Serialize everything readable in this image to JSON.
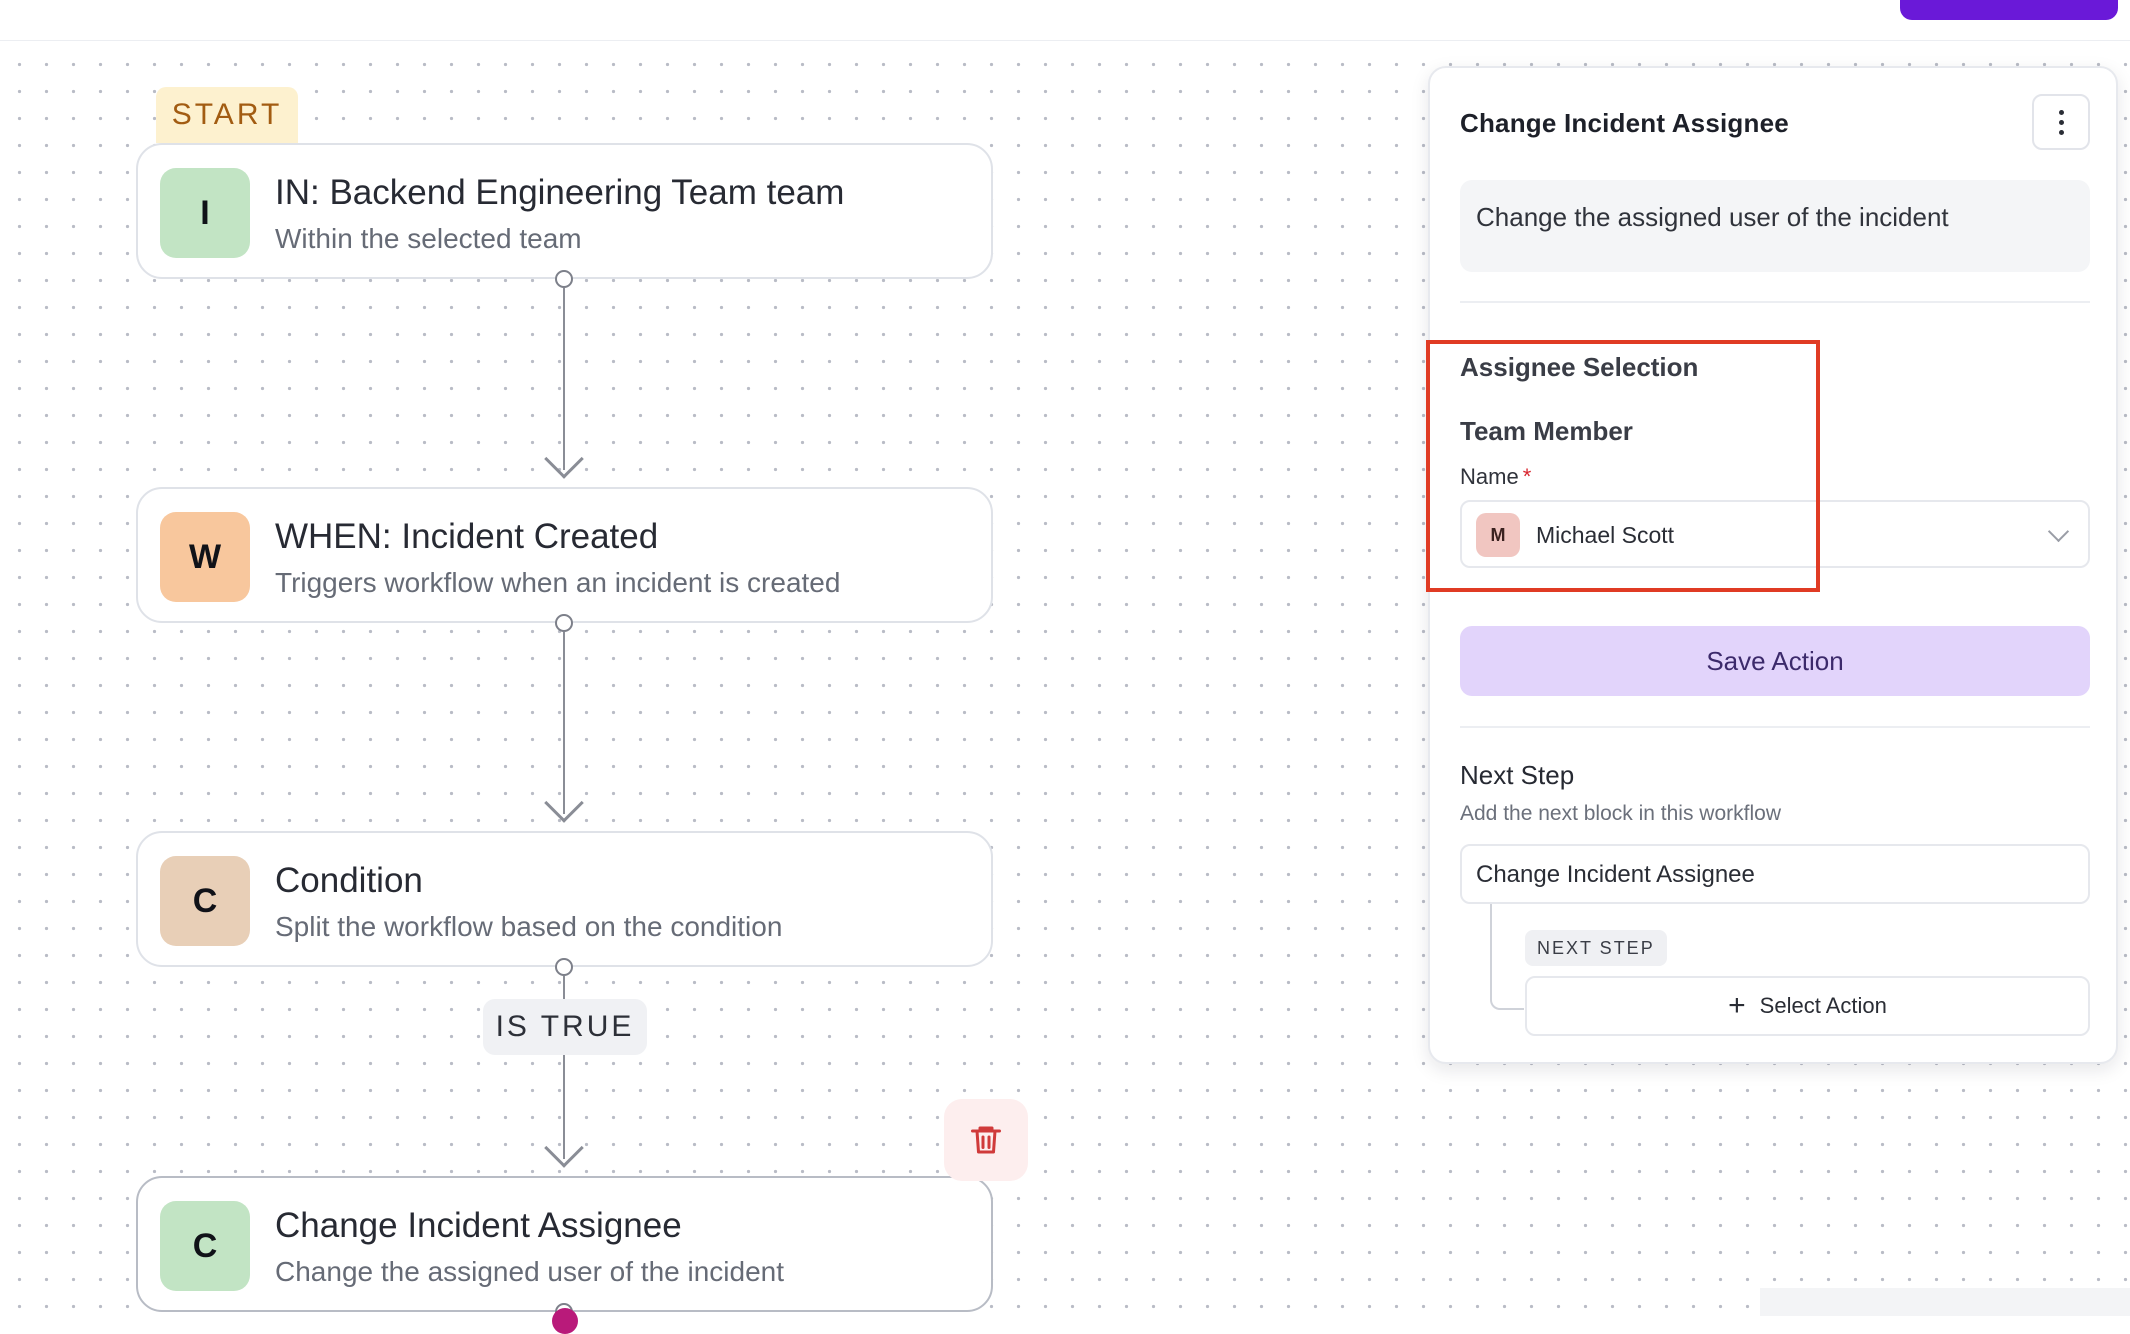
{
  "canvas": {
    "start_label": "START",
    "nodes": [
      {
        "badge": "I",
        "title": "IN: Backend Engineering Team team",
        "subtitle": "Within the selected team",
        "badge_color": "#c2e4c4"
      },
      {
        "badge": "W",
        "title": "WHEN: Incident Created",
        "subtitle": "Triggers workflow when an incident is created",
        "badge_color": "#f8c79d"
      },
      {
        "badge": "C",
        "title": "Condition",
        "subtitle": "Split the workflow based on the condition",
        "badge_color": "#e8cfb7"
      },
      {
        "badge": "C",
        "title": "Change Incident Assignee",
        "subtitle": "Change the assigned user of the incident",
        "badge_color": "#c2e4c4"
      }
    ],
    "branch_label": "IS TRUE",
    "delete_icon": "trash-icon"
  },
  "panel": {
    "title": "Change Incident Assignee",
    "description": "Change the assigned user of the incident",
    "section_title": "Assignee Selection",
    "subsection_title": "Team Member",
    "name_label": "Name",
    "required_mark": "*",
    "selected_avatar": "M",
    "selected_value": "Michael Scott",
    "save_label": "Save Action",
    "next_step": {
      "title": "Next Step",
      "subtitle": "Add the next block in this workflow",
      "current_block": "Change Incident Assignee",
      "tag": "NEXT STEP",
      "select_action_label": "Select Action"
    }
  },
  "colors": {
    "accent": "#6a19d8",
    "save_button_bg": "#e2d4fb",
    "highlight": "#e03b24",
    "delete": "#d03a3a"
  }
}
